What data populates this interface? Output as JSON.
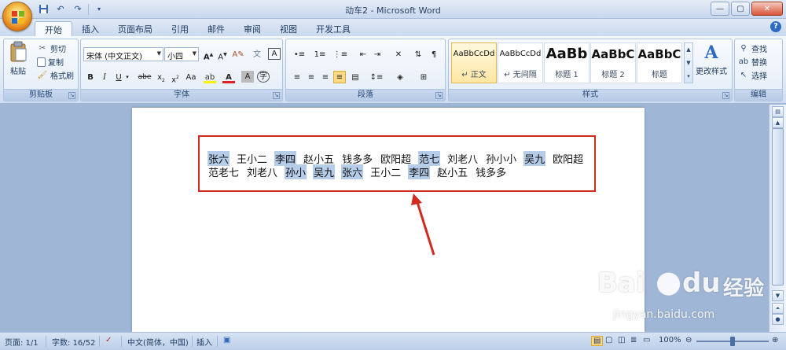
{
  "window": {
    "title": "动车2 - Microsoft Word"
  },
  "tabs": [
    "开始",
    "插入",
    "页面布局",
    "引用",
    "邮件",
    "审阅",
    "视图",
    "开发工具"
  ],
  "active_tab": "开始",
  "clipboard": {
    "paste": "粘贴",
    "cut": "剪切",
    "copy": "复制",
    "format_painter": "格式刷",
    "label": "剪贴板"
  },
  "font": {
    "name": "宋体 (中文正文)",
    "size": "小四",
    "label": "字体"
  },
  "paragraph": {
    "label": "段落"
  },
  "styles": {
    "label": "样式",
    "items": [
      {
        "sample": "AaBbCcDd",
        "name": "↵ 正文"
      },
      {
        "sample": "AaBbCcDd",
        "name": "↵ 无间隔"
      },
      {
        "sample": "AaBb",
        "name": "标题 1"
      },
      {
        "sample": "AaBbC",
        "name": "标题 2"
      },
      {
        "sample": "AaBbC",
        "name": "标题"
      }
    ],
    "change_styles": "更改样式"
  },
  "editing": {
    "find": "查找",
    "replace": "替换",
    "select": "选择",
    "label": "编辑"
  },
  "document": {
    "line1": [
      {
        "t": "张六",
        "hl": true
      },
      {
        "t": "王小二",
        "hl": false
      },
      {
        "t": "李四",
        "hl": true
      },
      {
        "t": "赵小五",
        "hl": false
      },
      {
        "t": "钱多多",
        "hl": false
      },
      {
        "t": "欧阳超",
        "hl": false
      },
      {
        "t": "范七",
        "hl": true
      },
      {
        "t": "刘老八",
        "hl": false
      },
      {
        "t": "孙小小",
        "hl": false
      },
      {
        "t": "吴九",
        "hl": true
      },
      {
        "t": "欧阳超",
        "hl": false
      }
    ],
    "line2": [
      {
        "t": "范老七",
        "hl": false
      },
      {
        "t": "刘老八",
        "hl": false
      },
      {
        "t": "孙小",
        "hl": true
      },
      {
        "t": "吴九",
        "hl": true
      },
      {
        "t": "张六",
        "hl": true
      },
      {
        "t": "王小二",
        "hl": false
      },
      {
        "t": "李四",
        "hl": true
      },
      {
        "t": "赵小五",
        "hl": false
      },
      {
        "t": "钱多多",
        "hl": false
      }
    ]
  },
  "status": {
    "page": "页面: 1/1",
    "words": "字数: 16/52",
    "language": "中文(简体，中国)",
    "mode": "插入",
    "zoom": "100%"
  },
  "watermark": {
    "brand": "Bai",
    "brand2": "du",
    "cn": "经验",
    "url": "jingyan.baidu.com"
  },
  "colors": {
    "highlight": "#b6cdea",
    "annotation": "#d12a1f",
    "ribbon": "#dfe9f6"
  }
}
